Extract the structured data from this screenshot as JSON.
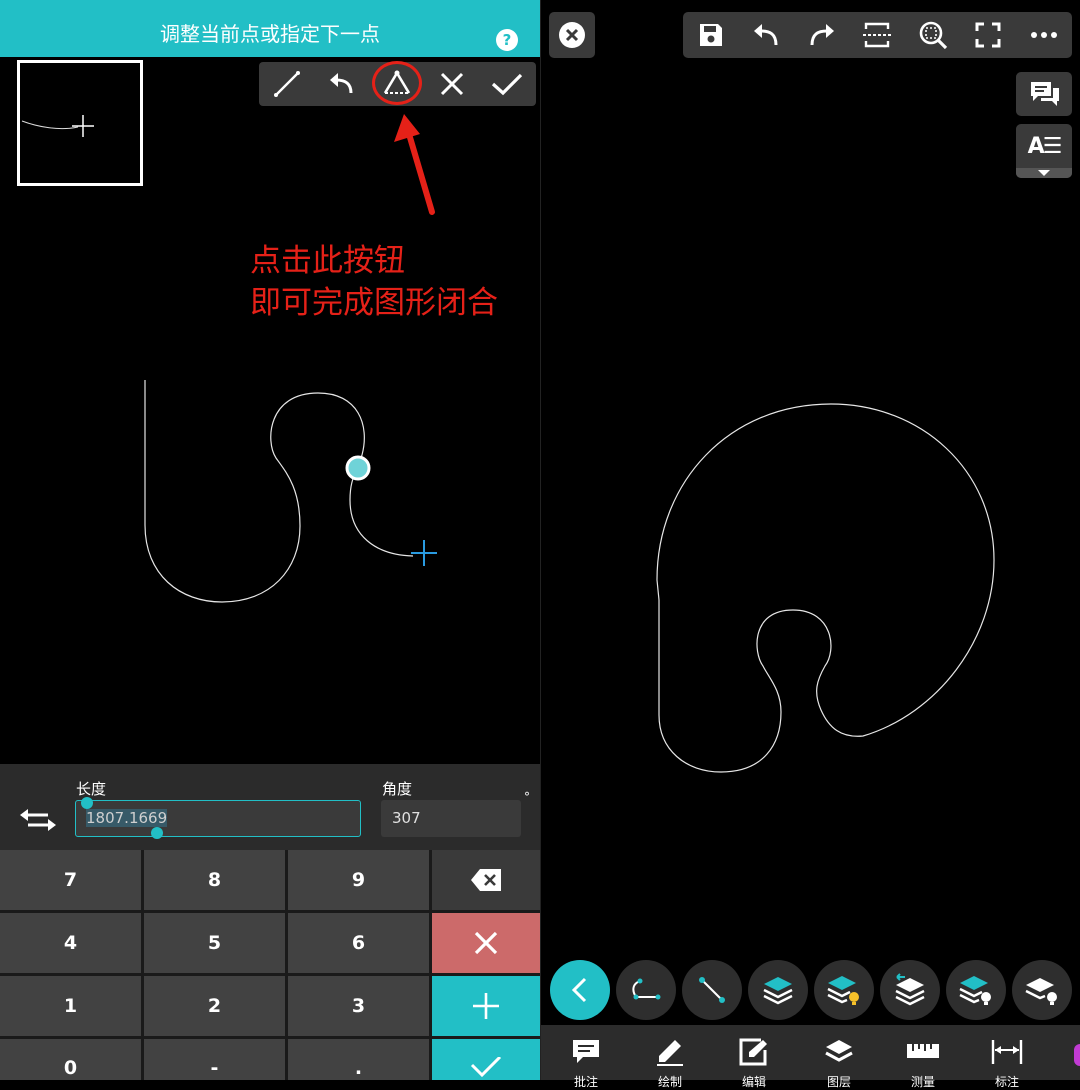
{
  "header": {
    "hint": "调整当前点或指定下一点",
    "help": "?"
  },
  "toolbar": {
    "icons": [
      "line-icon",
      "undo-icon",
      "close-shape-icon",
      "cancel-icon",
      "confirm-icon"
    ]
  },
  "annotation": {
    "line1": "点击此按钮",
    "line2": "即可完成图形闭合",
    "color": "#e52118"
  },
  "input": {
    "length_label": "长度",
    "length_value": "1807.1669",
    "angle_label": "角度",
    "angle_value": "307",
    "degree_symbol": "°"
  },
  "keypad": {
    "keys": [
      "7",
      "8",
      "9",
      "4",
      "5",
      "6",
      "1",
      "2",
      "3",
      "0",
      "-",
      "."
    ]
  },
  "right_toolbar": {
    "icons": [
      "save-icon",
      "undo-icon",
      "redo-icon",
      "section-icon",
      "zoom-window-icon",
      "fullscreen-icon",
      "more-icon"
    ]
  },
  "side_panel": {
    "text_style_label": "A☰"
  },
  "bottom_tools": {
    "icons": [
      "back-icon",
      "polyline-icon",
      "line-icon",
      "layer-icon",
      "layer-on-icon",
      "layer-arrange-icon",
      "layer-bulb-icon",
      "layer-off-icon"
    ]
  },
  "bottom_tabs": [
    {
      "label": "批注",
      "icon": "comment-icon"
    },
    {
      "label": "绘制",
      "icon": "pencil-icon"
    },
    {
      "label": "编辑",
      "icon": "edit-icon"
    },
    {
      "label": "图层",
      "icon": "layers-icon"
    },
    {
      "label": "测量",
      "icon": "ruler-icon"
    },
    {
      "label": "标注",
      "icon": "dimension-icon"
    }
  ],
  "colors": {
    "accent": "#22bfc6",
    "panel": "#3a3a3a",
    "key": "#424242",
    "danger_key": "#cc6a6a"
  }
}
